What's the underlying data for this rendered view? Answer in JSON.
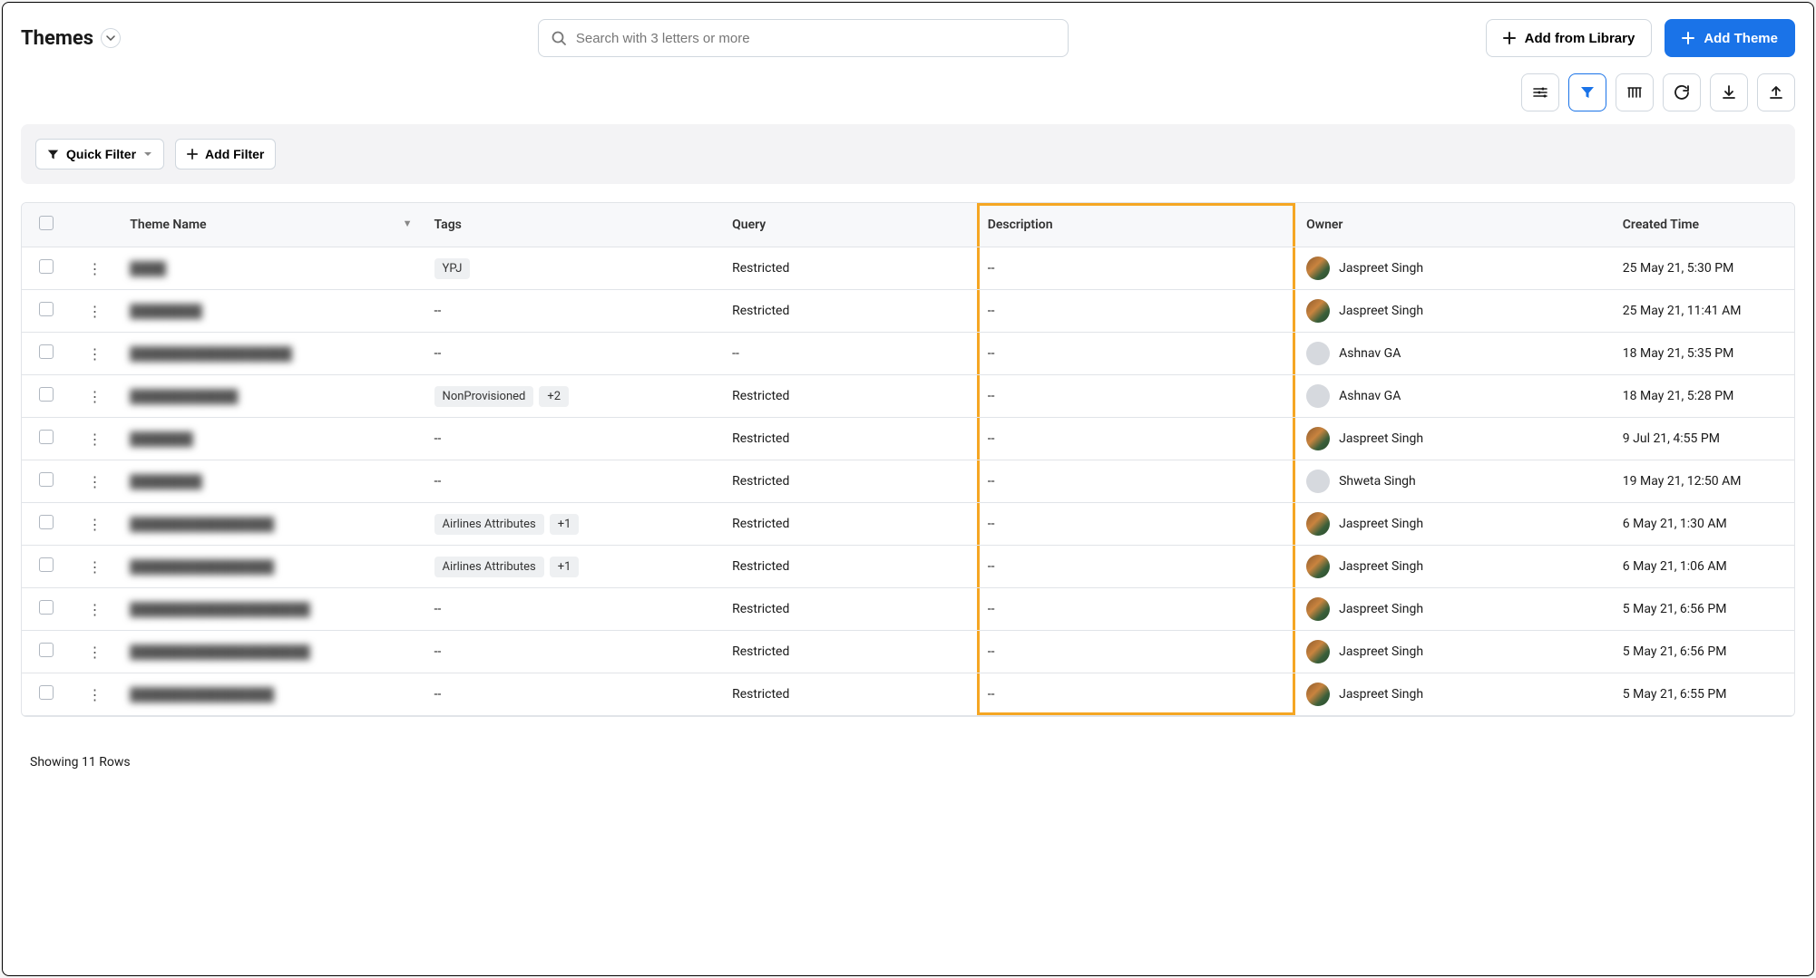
{
  "header": {
    "title": "Themes",
    "search_placeholder": "Search with 3 letters or more",
    "add_from_library": "Add from Library",
    "add_theme": "Add Theme"
  },
  "filters": {
    "quick_filter": "Quick Filter",
    "add_filter": "Add Filter"
  },
  "columns": {
    "name": "Theme Name",
    "tags": "Tags",
    "query": "Query",
    "description": "Description",
    "owner": "Owner",
    "created": "Created Time"
  },
  "rows": [
    {
      "name": "████",
      "tags": [
        {
          "t": "YPJ"
        }
      ],
      "query": "Restricted",
      "desc": "--",
      "owner": "Jaspreet Singh",
      "avatar": "img",
      "created": "25 May 21, 5:30 PM"
    },
    {
      "name": "████████",
      "tags_text": "--",
      "query": "Restricted",
      "desc": "--",
      "owner": "Jaspreet Singh",
      "avatar": "img",
      "created": "25 May 21, 11:41 AM"
    },
    {
      "name": "██████████████████",
      "tags_text": "--",
      "query": "--",
      "desc": "--",
      "owner": "Ashnav GA",
      "avatar": "empty",
      "created": "18 May 21, 5:35 PM"
    },
    {
      "name": "████████████",
      "tags": [
        {
          "t": "NonProvisioned"
        },
        {
          "t": "+2"
        }
      ],
      "query": "Restricted",
      "desc": "--",
      "owner": "Ashnav GA",
      "avatar": "empty",
      "created": "18 May 21, 5:28 PM"
    },
    {
      "name": "███████",
      "tags_text": "--",
      "query": "Restricted",
      "desc": "--",
      "owner": "Jaspreet Singh",
      "avatar": "img",
      "created": "9 Jul 21, 4:55 PM"
    },
    {
      "name": "████████",
      "tags_text": "--",
      "query": "Restricted",
      "desc": "--",
      "owner": "Shweta Singh",
      "avatar": "empty",
      "created": "19 May 21, 12:50 AM"
    },
    {
      "name": "████████████████",
      "tags": [
        {
          "t": "Airlines Attributes"
        },
        {
          "t": "+1"
        }
      ],
      "query": "Restricted",
      "desc": "--",
      "owner": "Jaspreet Singh",
      "avatar": "img",
      "created": "6 May 21, 1:30 AM"
    },
    {
      "name": "████████████████",
      "tags": [
        {
          "t": "Airlines Attributes"
        },
        {
          "t": "+1"
        }
      ],
      "query": "Restricted",
      "desc": "--",
      "owner": "Jaspreet Singh",
      "avatar": "img",
      "created": "6 May 21, 1:06 AM"
    },
    {
      "name": "████████████████████",
      "tags_text": "--",
      "query": "Restricted",
      "desc": "--",
      "owner": "Jaspreet Singh",
      "avatar": "img",
      "created": "5 May 21, 6:56 PM"
    },
    {
      "name": "████████████████████",
      "tags_text": "--",
      "query": "Restricted",
      "desc": "--",
      "owner": "Jaspreet Singh",
      "avatar": "img",
      "created": "5 May 21, 6:56 PM"
    },
    {
      "name": "████████████████",
      "tags_text": "--",
      "query": "Restricted",
      "desc": "--",
      "owner": "Jaspreet Singh",
      "avatar": "img",
      "created": "5 May 21, 6:55 PM"
    }
  ],
  "footer": {
    "showing": "Showing 11 Rows"
  }
}
